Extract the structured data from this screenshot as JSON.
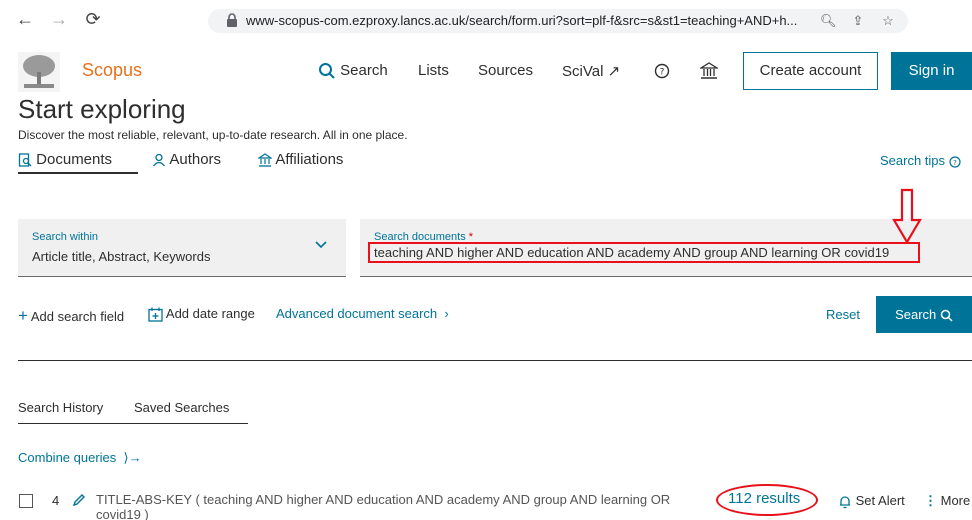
{
  "browser": {
    "url": "www-scopus-com.ezproxy.lancs.ac.uk/search/form.uri?sort=plf-f&src=s&st1=teaching+AND+h..."
  },
  "header": {
    "brand": "Scopus",
    "nav": [
      "Search",
      "Lists",
      "Sources",
      "SciVal ↗"
    ],
    "create_account": "Create account",
    "sign_in": "Sign in"
  },
  "page": {
    "title": "Start exploring",
    "subtitle": "Discover the most reliable, relevant, up-to-date research. All in one place.",
    "tabs": [
      "Documents",
      "Authors",
      "Affiliations"
    ],
    "search_tips": "Search tips"
  },
  "search": {
    "within_label": "Search within",
    "within_value": "Article title, Abstract, Keywords",
    "docs_label": "Search documents",
    "docs_required": "*",
    "query": "teaching AND higher AND education AND academy AND group AND learning OR covid19",
    "add_field": "Add search field",
    "add_date": "Add date range",
    "advanced": "Advanced document search",
    "reset": "Reset",
    "search_button": "Search"
  },
  "history": {
    "tabs": [
      "Search History",
      "Saved Searches"
    ],
    "combine": "Combine queries",
    "row": {
      "number": "4",
      "query": "TITLE-ABS-KEY ( teaching AND higher AND education AND academy AND group AND learning OR covid19 )",
      "results": "112 results",
      "set_alert": "Set Alert",
      "more": "More"
    }
  },
  "colors": {
    "accent": "#007398",
    "brand": "#e9711c",
    "annotation": "#e8101a"
  }
}
